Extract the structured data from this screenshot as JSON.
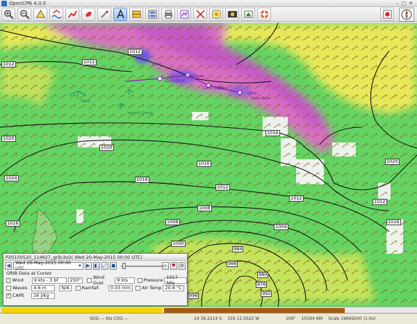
{
  "window": {
    "title": "OpenCPN 4.0.0",
    "buttons": [
      "–",
      "□",
      "✕"
    ]
  },
  "toolbar": {
    "icons": [
      "zoom-in-icon",
      "zoom-out-icon",
      "scale-icon",
      "tide-icon",
      "route-icon",
      "waypoint-icon",
      "ais-icon",
      "text-icon",
      "chart-quilt-icon",
      "settings-icon",
      "print-icon",
      "route-manager-icon",
      "track-icon",
      "color-scheme-icon",
      "grib-icon",
      "mob-icon",
      "lifebuoy-icon"
    ]
  },
  "contour_labels": [
    "1012",
    "1012",
    "1012",
    "1016",
    "1020",
    "1020",
    "1024",
    "1016",
    "1016",
    "1012",
    "1012",
    "1012",
    "1008",
    "1008",
    "1004",
    "1000",
    "1000",
    "996",
    "992",
    "988",
    "984",
    "980",
    "976",
    "1016",
    "1020",
    "1016"
  ],
  "markers": [
    {
      "label": "Tahiti"
    },
    {
      "label": "2105-0616"
    },
    {
      "label": "Borabora"
    },
    {
      "label": "1905-1530"
    },
    {
      "label": "1505-"
    },
    {
      "label": "0805-"
    },
    {
      "label": "Bora Bora"
    },
    {
      "label": "Tahiti"
    },
    {
      "label": "Vahaiti Group"
    }
  ],
  "grib": {
    "title": "P20150520_114627_grib.bz2( Wed 20-May-2015 00:00  UTC)",
    "date_selected": "Wed 20-May-2015 00:00  UTC",
    "section_label": "GRIB Data at Cursor",
    "wind_label": "Wind",
    "wind_value": "9 kts - 3 bf",
    "wind_dir": "250°",
    "wind_gust_label": "Wind Gust",
    "wind_gust_value": "9 kts",
    "pressure_label": "Pressure",
    "pressure_value": "1017 hPa",
    "waves_label": "Waves",
    "waves_value": "4.6 m",
    "waves_dir": "N/A",
    "rainfall_label": "Rainfall",
    "rainfall_value": "0.03 mm",
    "airtemp_label": "Air Temp",
    "airtemp_value": "20.8 °C",
    "cape_label": "CAPE",
    "cape_value": "16 j/kg"
  },
  "status": {
    "sog": "SOG --- kts COG ---",
    "lat": "24 36.2214 S",
    "lon": "159 12.5022 W",
    "bearing": "109°",
    "dist": "10184 NM",
    "scale": "Scale 19669200 (1.0x)"
  },
  "colors": {
    "wind_green": "#63d463",
    "wind_yellow": "#e6e85a",
    "wind_magenta": "#d86fc2",
    "wind_purple": "#8a5de0"
  }
}
